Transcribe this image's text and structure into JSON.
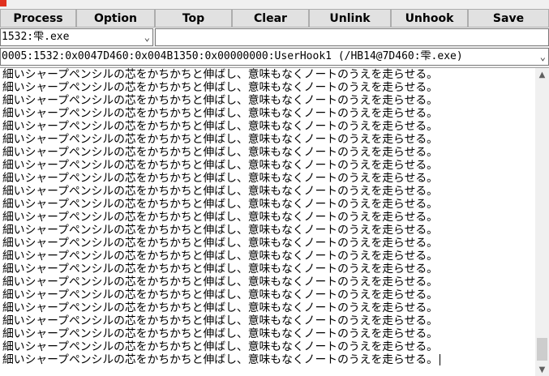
{
  "toolbar": {
    "buttons": [
      "Process",
      "Option",
      "Top",
      "Clear",
      "Unlink",
      "Unhook",
      "Save"
    ]
  },
  "process_select": {
    "value": "1532:雫.exe"
  },
  "text_input": {
    "value": ""
  },
  "hook_select": {
    "value": "0005:1532:0x0047D460:0x004B1350:0x00000000:UserHook1 (/HB14@7D460:雫.exe)"
  },
  "output": {
    "lines": [
      "細いシャープペンシルの芯をかちかちと伸ばし、意味もなくノートのうえを走らせる。",
      "細いシャープペンシルの芯をかちかちと伸ばし、意味もなくノートのうえを走らせる。",
      "細いシャープペンシルの芯をかちかちと伸ばし、意味もなくノートのうえを走らせる。",
      "細いシャープペンシルの芯をかちかちと伸ばし、意味もなくノートのうえを走らせる。",
      "細いシャープペンシルの芯をかちかちと伸ばし、意味もなくノートのうえを走らせる。",
      "細いシャープペンシルの芯をかちかちと伸ばし、意味もなくノートのうえを走らせる。",
      "細いシャープペンシルの芯をかちかちと伸ばし、意味もなくノートのうえを走らせる。",
      "細いシャープペンシルの芯をかちかちと伸ばし、意味もなくノートのうえを走らせる。",
      "細いシャープペンシルの芯をかちかちと伸ばし、意味もなくノートのうえを走らせる。",
      "細いシャープペンシルの芯をかちかちと伸ばし、意味もなくノートのうえを走らせる。",
      "細いシャープペンシルの芯をかちかちと伸ばし、意味もなくノートのうえを走らせる。",
      "細いシャープペンシルの芯をかちかちと伸ばし、意味もなくノートのうえを走らせる。",
      "細いシャープペンシルの芯をかちかちと伸ばし、意味もなくノートのうえを走らせる。",
      "細いシャープペンシルの芯をかちかちと伸ばし、意味もなくノートのうえを走らせる。",
      "細いシャープペンシルの芯をかちかちと伸ばし、意味もなくノートのうえを走らせる。",
      "細いシャープペンシルの芯をかちかちと伸ばし、意味もなくノートのうえを走らせる。",
      "細いシャープペンシルの芯をかちかちと伸ばし、意味もなくノートのうえを走らせる。",
      "細いシャープペンシルの芯をかちかちと伸ばし、意味もなくノートのうえを走らせる。",
      "細いシャープペンシルの芯をかちかちと伸ばし、意味もなくノートのうえを走らせる。",
      "細いシャープペンシルの芯をかちかちと伸ばし、意味もなくノートのうえを走らせる。",
      "細いシャープペンシルの芯をかちかちと伸ばし、意味もなくノートのうえを走らせる。",
      "細いシャープペンシルの芯をかちかちと伸ばし、意味もなくノートのうえを走らせる。",
      "細いシャープペンシルの芯をかちかちと伸ばし、意味もなくノートのうえを走らせる。"
    ]
  },
  "icons": {
    "app_icon": "app-icon",
    "dropdown": "chevron-down-icon",
    "scroll_up": "scroll-up-arrow-icon",
    "scroll_down": "scroll-down-arrow-icon"
  },
  "colors": {
    "app_icon": "#e0301e",
    "button_face": "#e1e1e1",
    "window_bg": "#f0f0f0"
  },
  "scroll": {
    "thumb_start": 0.91,
    "thumb_end": 0.99
  }
}
